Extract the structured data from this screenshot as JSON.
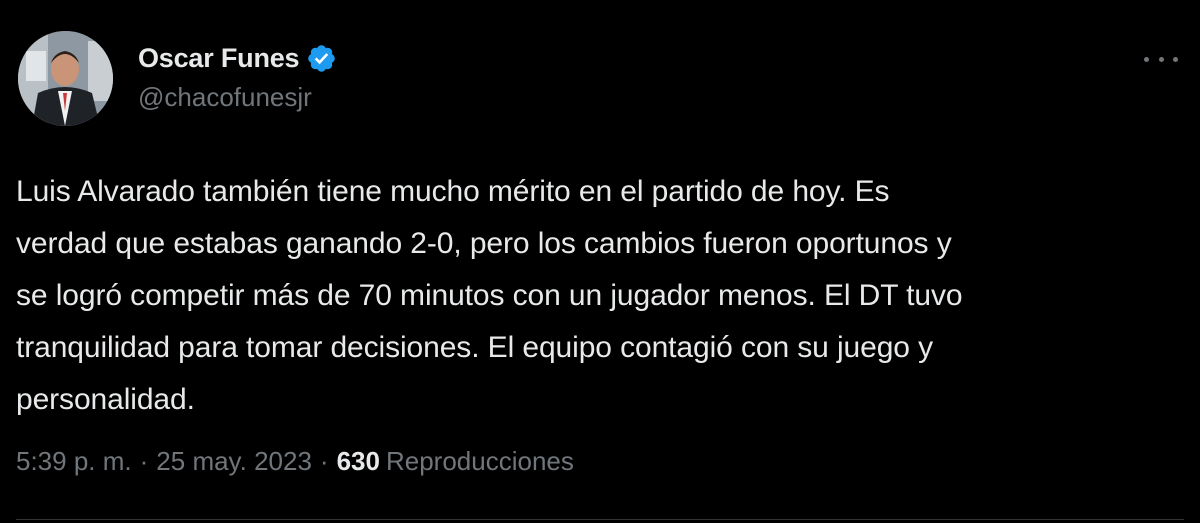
{
  "author": {
    "display_name": "Oscar Funes",
    "handle": "@chacofunesjr",
    "verified": true,
    "verified_color": "#1d9bf0"
  },
  "tweet": {
    "text": "Luis Alvarado también tiene mucho mérito en el partido de hoy. Es verdad que estabas ganando 2-0, pero los cambios fueron oportunos y se logró competir más de 70 minutos con un jugador menos. El DT tuvo tranquilidad para tomar decisiones. El equipo contagió con su juego y personalidad.",
    "lines": [
      "Luis Alvarado también tiene mucho mérito en el partido de hoy. Es",
      "verdad que estabas ganando 2-0, pero los cambios fueron oportunos y",
      "se logró competir más de 70 minutos con un jugador menos. El DT tuvo",
      "tranquilidad para tomar decisiones. El equipo contagió con su juego y",
      "personalidad."
    ]
  },
  "meta": {
    "time": "5:39 p. m.",
    "separator": "·",
    "date": "25 may. 2023",
    "views_count": "630",
    "views_label": "Reproducciones"
  },
  "icons": {
    "more": "more-options-icon",
    "verified": "verified-badge-icon"
  },
  "colors": {
    "background": "#000000",
    "primary_text": "#e7e9ea",
    "secondary_text": "#71767b"
  }
}
